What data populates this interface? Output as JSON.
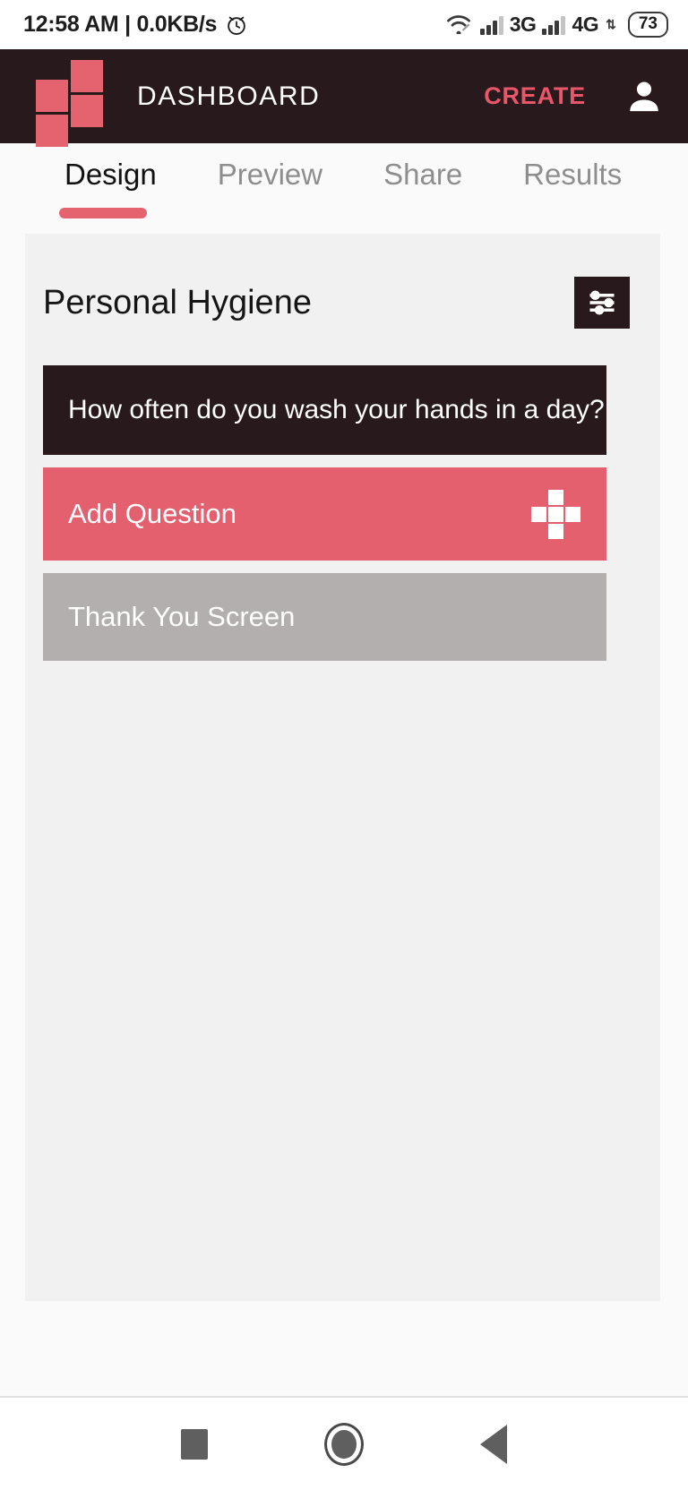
{
  "status_bar": {
    "time": "12:58 AM",
    "separator": "|",
    "data_rate": "0.0KB/s",
    "alarm_icon": "alarm-clock-icon",
    "wifi_icon": "wifi-icon",
    "network_1": "3G",
    "network_2": "4G",
    "battery_level": "73"
  },
  "app_bar": {
    "logo_icon": "app-logo-squares",
    "title": "DASHBOARD",
    "create_label": "CREATE",
    "account_icon": "account-person-icon",
    "background": "#281A1C",
    "accent": "#E8566A"
  },
  "tabs": [
    {
      "label": "Design",
      "active": true
    },
    {
      "label": "Preview",
      "active": false
    },
    {
      "label": "Share",
      "active": false
    },
    {
      "label": "Results",
      "active": false
    }
  ],
  "survey": {
    "title": "Personal Hygiene",
    "settings_icon": "sliders-settings-icon",
    "rows": [
      {
        "label": "How often do you wash your hands in a day?",
        "type": "question",
        "color": "#281A1C"
      },
      {
        "label": "Add Question",
        "type": "add",
        "color": "#E4606F",
        "icon": "plus-icon"
      },
      {
        "label": "Thank You Screen",
        "type": "thank-you",
        "color": "#B3AFAE"
      }
    ]
  },
  "nav_bar": {
    "recents_icon": "recents-square-icon",
    "home_icon": "home-circle-icon",
    "back_icon": "back-triangle-icon"
  }
}
